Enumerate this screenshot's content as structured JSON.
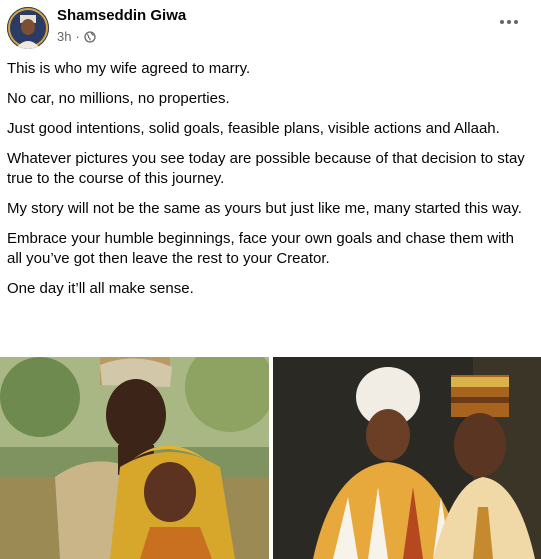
{
  "post": {
    "author": {
      "name": "Shamseddin Giwa",
      "avatar_icon": "profile-avatar"
    },
    "meta": {
      "time": "3h",
      "separator": "·",
      "audience_icon": "globe-icon"
    },
    "menu_icon": "more-options-icon",
    "paragraphs": [
      "This is who my wife agreed to marry.",
      "No car, no millions, no properties.",
      "Just good intentions, solid goals, feasible plans, visible actions and Allaah.",
      "Whatever pictures you see today are possible because of that decision to stay true to the course of this journey.",
      "My story will not be the same as yours but just like me, many started this way.",
      "Embrace your humble beginnings, face your own goals and chase them with all you’ve got then leave the rest to your Creator.",
      "One day it’ll all make sense."
    ],
    "photos": [
      {
        "icon": "couple-photo-old"
      },
      {
        "icon": "couple-photo-recent"
      }
    ]
  }
}
